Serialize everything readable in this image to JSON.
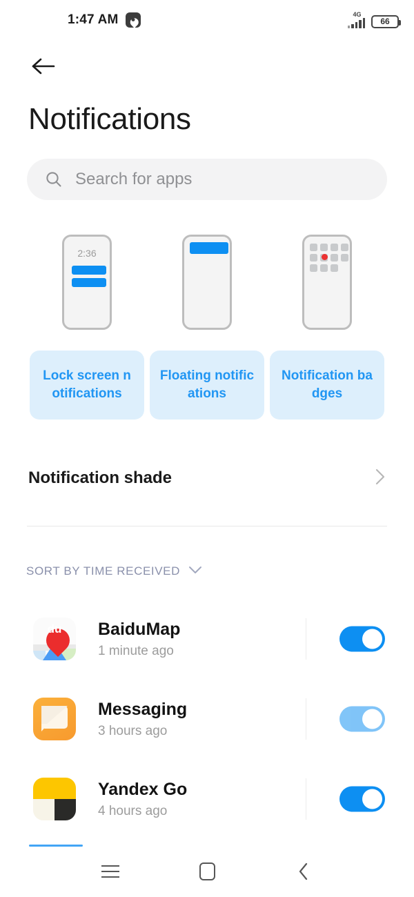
{
  "status_bar": {
    "time": "1:47 AM",
    "app_icon": "map-pin-icon",
    "network_type": "4G",
    "battery_percent": "66"
  },
  "header": {
    "back_icon": "arrow-left-icon",
    "title": "Notifications"
  },
  "search": {
    "icon": "search-icon",
    "placeholder": "Search for apps",
    "value": ""
  },
  "feature_cards": [
    {
      "label": "Lock screen notifications",
      "illustration": "lock-screen-preview",
      "preview_time": "2:36"
    },
    {
      "label": "Floating notifications",
      "illustration": "floating-notification-preview"
    },
    {
      "label": "Notification badges",
      "illustration": "notification-badge-preview"
    }
  ],
  "shade_row": {
    "title": "Notification shade",
    "chevron_icon": "chevron-right-icon"
  },
  "sort": {
    "label": "SORT BY TIME RECEIVED",
    "chevron_icon": "chevron-down-icon"
  },
  "apps": [
    {
      "name": "BaiduMap",
      "time": "1 minute ago",
      "icon": "baidumap-icon",
      "enabled": true,
      "toggle_state": "on"
    },
    {
      "name": "Messaging",
      "time": "3 hours ago",
      "icon": "messaging-icon",
      "enabled": true,
      "toggle_state": "on-dimmed"
    },
    {
      "name": "Yandex Go",
      "time": "4 hours ago",
      "icon": "yandex-go-icon",
      "enabled": true,
      "toggle_state": "on"
    }
  ],
  "navbar": {
    "recents_icon": "menu-icon",
    "home_icon": "square-icon",
    "back_icon": "chevron-left-icon"
  },
  "colors": {
    "accent_blue": "#0d8ff2",
    "card_blue_bg": "#ddeffc",
    "card_blue_text": "#2196f3",
    "badge_red": "#ec3232",
    "sort_label": "#8a90ab"
  }
}
